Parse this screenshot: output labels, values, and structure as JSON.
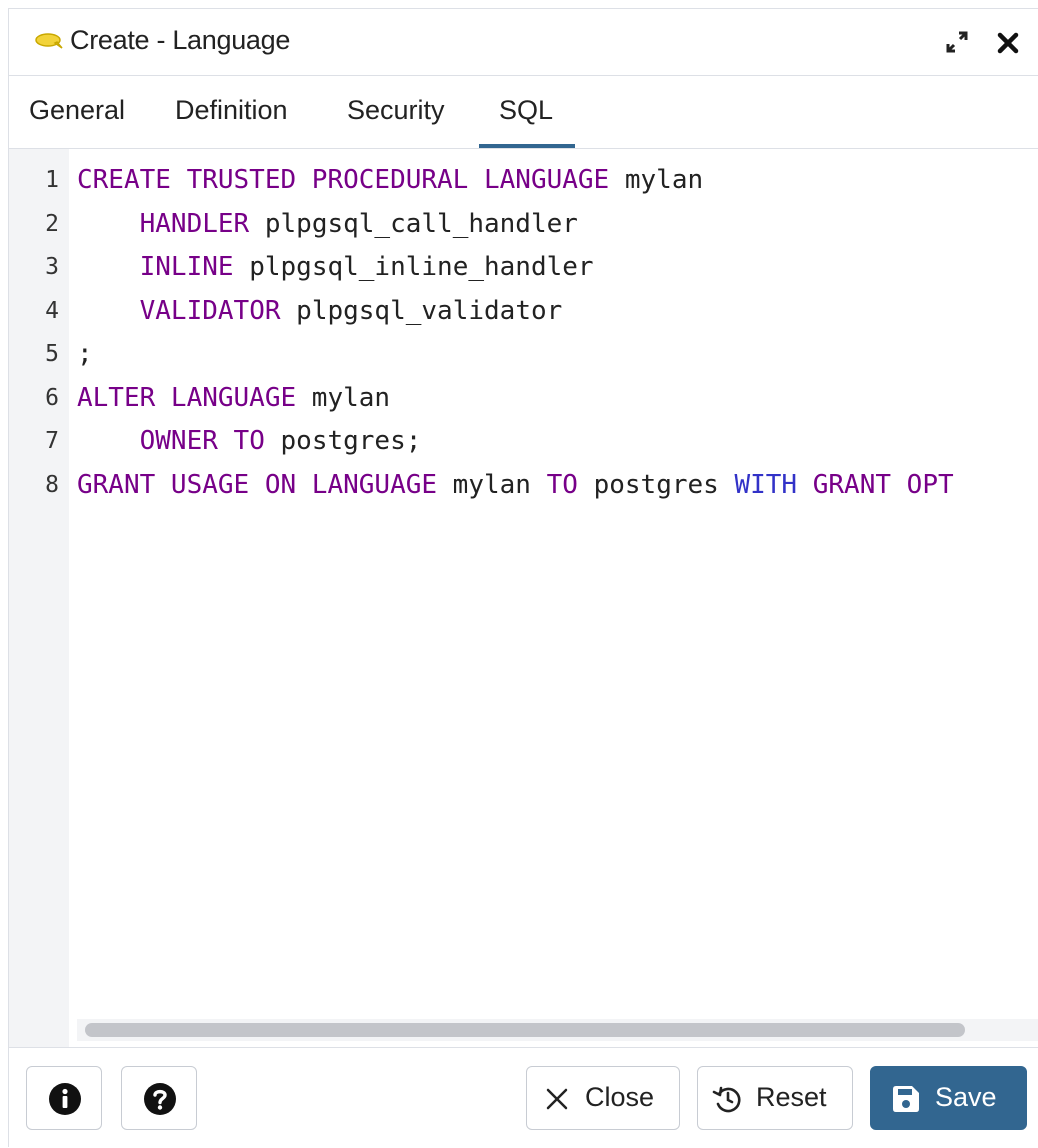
{
  "dialog": {
    "title": "Create - Language",
    "icon": "language-icon",
    "maximize_icon": "maximize-icon",
    "close_icon": "close-icon"
  },
  "tabs": [
    {
      "label": "General",
      "active": false
    },
    {
      "label": "Definition",
      "active": false
    },
    {
      "label": "Security",
      "active": false
    },
    {
      "label": "SQL",
      "active": true
    }
  ],
  "editor": {
    "line_numbers": [
      "1",
      "2",
      "3",
      "4",
      "5",
      "6",
      "7",
      "8"
    ],
    "lines": [
      [
        {
          "t": "CREATE TRUSTED PROCEDURAL LANGUAGE",
          "c": "kw"
        },
        {
          "t": " mylan",
          "c": ""
        }
      ],
      [
        {
          "t": "    ",
          "c": ""
        },
        {
          "t": "HANDLER",
          "c": "kw"
        },
        {
          "t": " plpgsql_call_handler",
          "c": ""
        }
      ],
      [
        {
          "t": "    ",
          "c": ""
        },
        {
          "t": "INLINE",
          "c": "kw"
        },
        {
          "t": " plpgsql_inline_handler",
          "c": ""
        }
      ],
      [
        {
          "t": "    ",
          "c": ""
        },
        {
          "t": "VALIDATOR",
          "c": "kw"
        },
        {
          "t": " plpgsql_validator",
          "c": ""
        }
      ],
      [
        {
          "t": ";",
          "c": ""
        }
      ],
      [
        {
          "t": "ALTER LANGUAGE",
          "c": "kw"
        },
        {
          "t": " mylan",
          "c": ""
        }
      ],
      [
        {
          "t": "    ",
          "c": ""
        },
        {
          "t": "OWNER TO",
          "c": "kw"
        },
        {
          "t": " postgres;",
          "c": ""
        }
      ],
      [
        {
          "t": "GRANT USAGE ON LANGUAGE",
          "c": "kw"
        },
        {
          "t": " mylan ",
          "c": ""
        },
        {
          "t": "TO",
          "c": "kw"
        },
        {
          "t": " postgres ",
          "c": ""
        },
        {
          "t": "WITH",
          "c": "kw2"
        },
        {
          "t": " ",
          "c": ""
        },
        {
          "t": "GRANT OPT",
          "c": "kw"
        }
      ]
    ]
  },
  "footer": {
    "info_icon": "info-icon",
    "help_icon": "help-icon",
    "close_label": "Close",
    "reset_label": "Reset",
    "save_label": "Save"
  },
  "colors": {
    "accent": "#326690",
    "keyword": "#770088",
    "keyword_alt": "#3232c8",
    "language_icon": "#f2d33a"
  }
}
